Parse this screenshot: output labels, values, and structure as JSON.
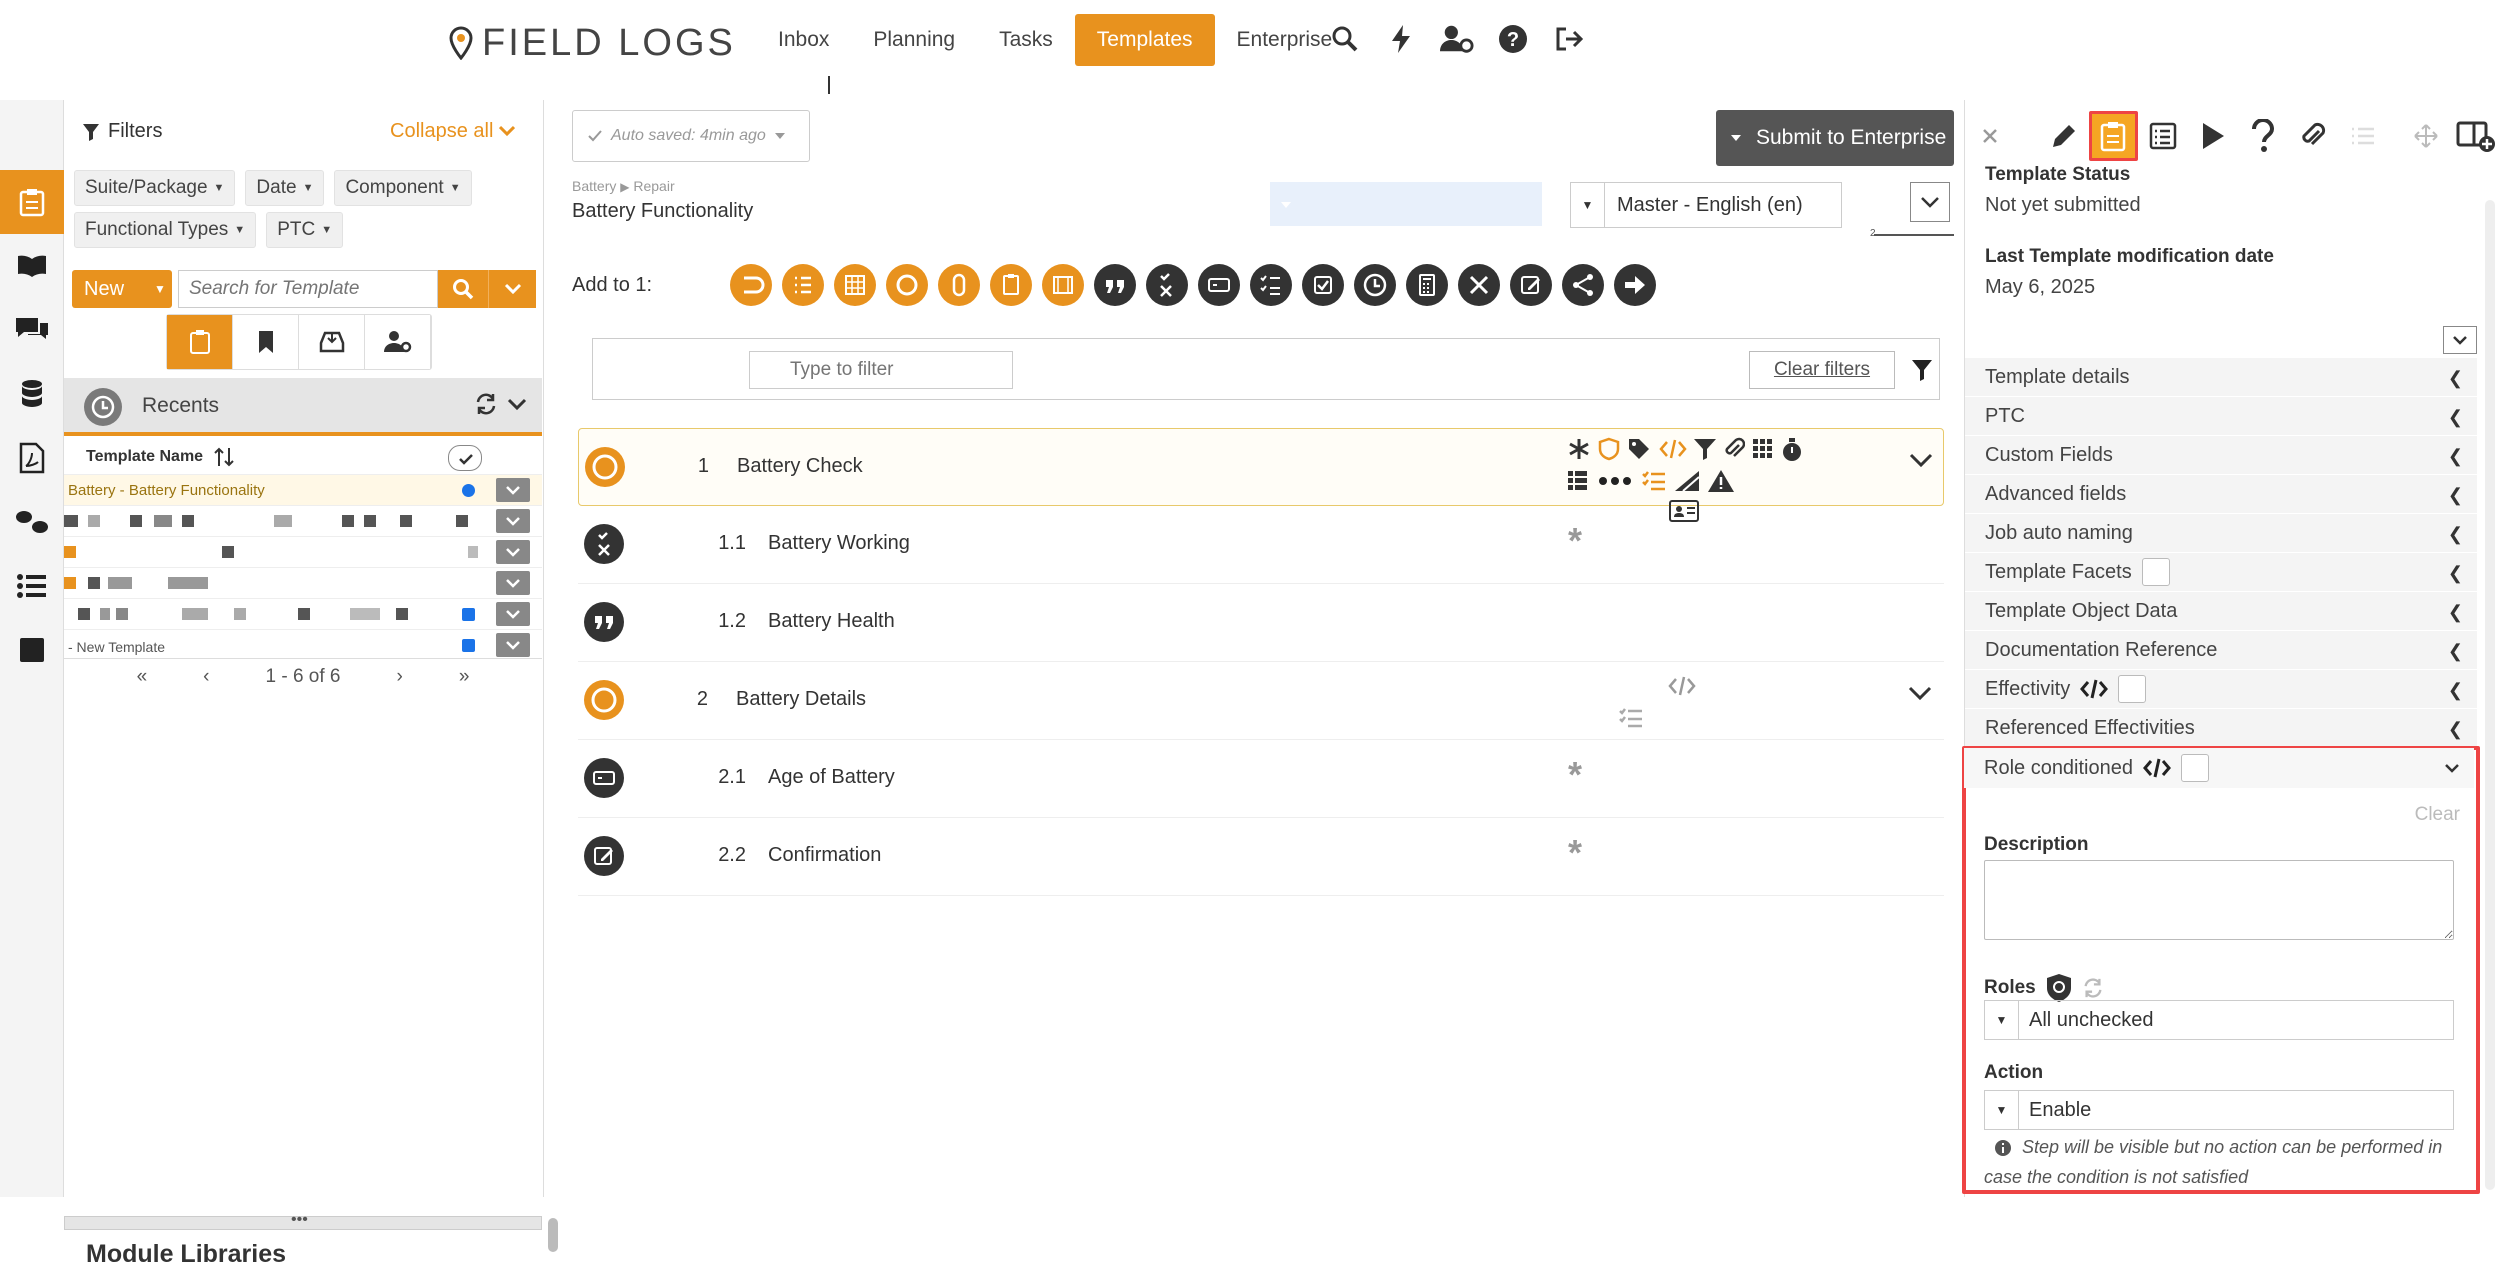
{
  "app": {
    "logo_text": "FIELD LOGS",
    "accent": "#e8921e"
  },
  "nav": {
    "items": [
      "Inbox",
      "Planning",
      "Tasks",
      "Templates",
      "Enterprise"
    ],
    "active": "Templates",
    "icons": [
      "search-icon",
      "lightning-icon",
      "user-settings-icon",
      "help-icon",
      "logout-icon"
    ]
  },
  "left_rail": {
    "icons": [
      "clipboard-icon",
      "book-icon",
      "comments-icon",
      "database-icon",
      "pdf-icon",
      "shoes-icon",
      "list-icon",
      "square-icon"
    ]
  },
  "filters": {
    "title": "Filters",
    "collapse_all": "Collapse all",
    "chips": [
      "Suite/Package",
      "Date",
      "Component",
      "Functional Types",
      "PTC"
    ],
    "new_label": "New",
    "search_placeholder": "Search for Template",
    "recents_label": "Recents",
    "table_header": "Template Name",
    "rows": [
      {
        "name": "Battery - Battery Functionality",
        "dot": "#1a73e8",
        "selected": true
      },
      {
        "name": "",
        "dot": "",
        "selected": false
      },
      {
        "name": "",
        "dot": "",
        "selected": false
      },
      {
        "name": "",
        "dot": "",
        "selected": false
      },
      {
        "name": "",
        "dot": "#1a73e8",
        "selected": false
      },
      {
        "name": "- New Template",
        "dot": "#1a73e8",
        "selected": false
      }
    ],
    "pager": {
      "first": "«",
      "prev": "‹",
      "range": "1 - 6 of 6",
      "next": "›",
      "last": "»"
    },
    "module_libraries": "Module Libraries"
  },
  "editor": {
    "autosave": "Auto saved: 4min ago",
    "submit": "Submit to Enterprise",
    "breadcrumb": [
      "Battery",
      "Repair"
    ],
    "template_name": "Battery Functionality",
    "language": "Master - English (en)",
    "zoom_level": "2",
    "add_to": "Add to 1:",
    "filter_placeholder": "Type to filter",
    "clear_filters": "Clear filters",
    "steps": [
      {
        "num": "1",
        "title": "Battery Check",
        "level": 0,
        "icon": "circle-step-icon",
        "active": true
      },
      {
        "num": "1.1",
        "title": "Battery Working",
        "level": 1,
        "icon": "pass-fail-icon",
        "active": false
      },
      {
        "num": "1.2",
        "title": "Battery Health",
        "level": 1,
        "icon": "quote-icon",
        "active": false
      },
      {
        "num": "2",
        "title": "Battery Details",
        "level": 0,
        "icon": "circle-step-icon",
        "active": false
      },
      {
        "num": "2.1",
        "title": "Age of Battery",
        "level": 1,
        "icon": "input-field-icon",
        "active": false
      },
      {
        "num": "2.2",
        "title": "Confirmation",
        "level": 1,
        "icon": "signature-icon",
        "active": false
      }
    ]
  },
  "right_panel": {
    "status_label": "Template Status",
    "status_value": "Not yet submitted",
    "mod_label": "Last Template modification date",
    "mod_value": "May 6, 2025",
    "sections": [
      "Template details",
      "PTC",
      "Custom Fields",
      "Advanced fields",
      "Job auto naming",
      "Template Facets",
      "Template Object Data",
      "Documentation Reference",
      "Effectivity",
      "Referenced Effectivities"
    ],
    "role_conditioned": {
      "title": "Role conditioned",
      "clear": "Clear",
      "description_label": "Description",
      "roles_label": "Roles",
      "roles_value": "All unchecked",
      "action_label": "Action",
      "action_value": "Enable",
      "hint": "Step will be visible but no action can be performed in case the condition is not satisfied"
    }
  }
}
